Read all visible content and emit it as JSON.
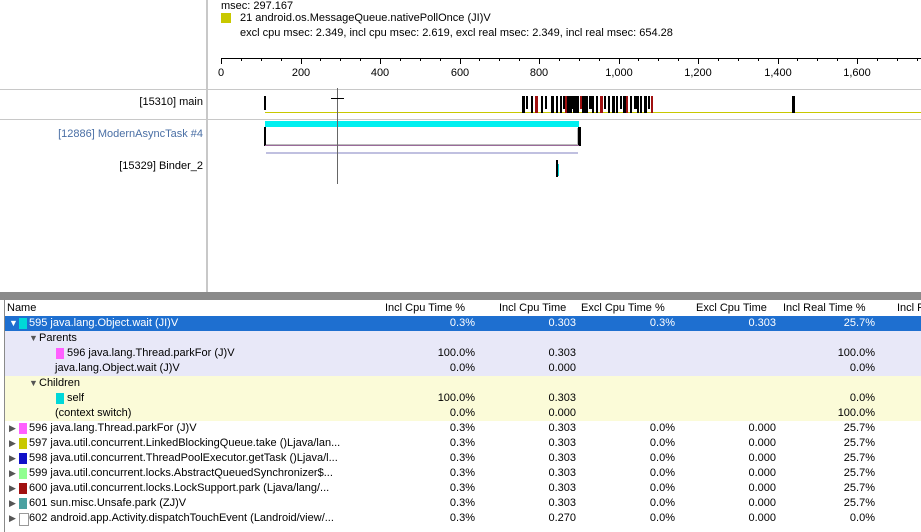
{
  "info": {
    "line1": "msec: 297.167",
    "line2": "21 android.os.MessageQueue.nativePollOnce (JI)V",
    "line3": "excl cpu msec: 2.349, incl cpu msec: 2.619, excl real msec: 2.349, incl real msec: 654.28",
    "swatch_color": "#c8c800"
  },
  "axis": {
    "ticks": [
      "0",
      "200",
      "400",
      "600",
      "800",
      "1,000",
      "1,200",
      "1,400",
      "1,600"
    ]
  },
  "threads": [
    {
      "label": "[15310] main",
      "color": "#000000"
    },
    {
      "label": "[12886] ModernAsyncTask #4",
      "color": "#4a6fa5"
    },
    {
      "label": "[15329] Binder_2",
      "color": "#000000"
    }
  ],
  "table": {
    "columns": [
      "Name",
      "Incl Cpu Time %",
      "Incl Cpu Time",
      "Excl Cpu Time %",
      "Excl Cpu Time",
      "Incl Real Time %",
      "Incl R"
    ],
    "rows": [
      {
        "kind": "selected",
        "name": "595 java.lang.Object.wait (JI)V",
        "color": "#00d8d8",
        "tri": "▼",
        "c1": "0.3%",
        "c2": "0.303",
        "c3": "0.3%",
        "c4": "0.303",
        "c5": "25.7%"
      },
      {
        "kind": "parents-header",
        "name": "Parents",
        "tri": "▼",
        "c1": "",
        "c2": "",
        "c3": "",
        "c4": "",
        "c5": ""
      },
      {
        "kind": "parents",
        "name": "596 java.lang.Thread.parkFor (J)V",
        "color": "#ff60ff",
        "c1": "100.0%",
        "c2": "0.303",
        "c3": "",
        "c4": "",
        "c5": "100.0%"
      },
      {
        "kind": "parents",
        "name": "java.lang.Object.wait (J)V",
        "c1": "0.0%",
        "c2": "0.000",
        "c3": "",
        "c4": "",
        "c5": "0.0%"
      },
      {
        "kind": "children-header",
        "name": "Children",
        "tri": "▼",
        "c1": "",
        "c2": "",
        "c3": "",
        "c4": "",
        "c5": ""
      },
      {
        "kind": "children",
        "name": "self",
        "color": "#00d8d8",
        "c1": "100.0%",
        "c2": "0.303",
        "c3": "",
        "c4": "",
        "c5": "0.0%"
      },
      {
        "kind": "children",
        "name": "(context switch)",
        "c1": "0.0%",
        "c2": "0.000",
        "c3": "",
        "c4": "",
        "c5": "100.0%"
      },
      {
        "kind": "normal",
        "name": "596 java.lang.Thread.parkFor (J)V",
        "color": "#ff60ff",
        "tri": "▶",
        "c1": "0.3%",
        "c2": "0.303",
        "c3": "0.0%",
        "c4": "0.000",
        "c5": "25.7%"
      },
      {
        "kind": "normal",
        "name": "597 java.util.concurrent.LinkedBlockingQueue.take ()Ljava/lan...",
        "color": "#c8c800",
        "tri": "▶",
        "c1": "0.3%",
        "c2": "0.303",
        "c3": "0.0%",
        "c4": "0.000",
        "c5": "25.7%"
      },
      {
        "kind": "normal",
        "name": "598 java.util.concurrent.ThreadPoolExecutor.getTask ()Ljava/l...",
        "color": "#1010c8",
        "tri": "▶",
        "c1": "0.3%",
        "c2": "0.303",
        "c3": "0.0%",
        "c4": "0.000",
        "c5": "25.7%"
      },
      {
        "kind": "normal",
        "name": "599 java.util.concurrent.locks.AbstractQueuedSynchronizer$...",
        "color": "#90ff90",
        "tri": "▶",
        "c1": "0.3%",
        "c2": "0.303",
        "c3": "0.0%",
        "c4": "0.000",
        "c5": "25.7%"
      },
      {
        "kind": "normal",
        "name": "600 java.util.concurrent.locks.LockSupport.park (Ljava/lang/...",
        "color": "#a01010",
        "tri": "▶",
        "c1": "0.3%",
        "c2": "0.303",
        "c3": "0.0%",
        "c4": "0.000",
        "c5": "25.7%"
      },
      {
        "kind": "normal",
        "name": "601 sun.misc.Unsafe.park (ZJ)V",
        "color": "#4aa0a0",
        "tri": "▶",
        "c1": "0.3%",
        "c2": "0.303",
        "c3": "0.0%",
        "c4": "0.000",
        "c5": "25.7%"
      },
      {
        "kind": "normal",
        "name": "602 android.app.Activity.dispatchTouchEvent (Landroid/view/...",
        "color": "#ffffff",
        "tri": "▶",
        "c1": "0.3%",
        "c2": "0.270",
        "c3": "0.0%",
        "c4": "0.000",
        "c5": "0.0%"
      }
    ]
  }
}
